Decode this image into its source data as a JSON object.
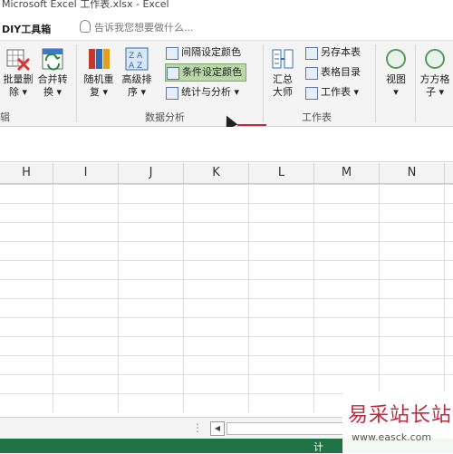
{
  "window": {
    "title": "Microsoft Excel 工作表.xlsx - Excel"
  },
  "tabs": {
    "diy": "DIY工具箱",
    "tell_me": "告诉我您想要做什么..."
  },
  "ribbon": {
    "buttons": {
      "batch_delete": [
        "批量删",
        "除 ▾"
      ],
      "merge_convert": [
        "合并转",
        "换 ▾"
      ],
      "random_repeat": [
        "随机重",
        "复 ▾"
      ],
      "advanced_sort": [
        "高级排",
        "序 ▾"
      ],
      "summary": [
        "汇总",
        "大师"
      ],
      "view": [
        "视图",
        "▾"
      ],
      "grid_sub": [
        "方方格",
        "子 ▾"
      ]
    },
    "small": {
      "interval_color": "间隔设定颜色",
      "conditional_color": "条件设定颜色",
      "stats_analysis": "统计与分析 ▾",
      "save_copy": "另存本表",
      "table_index": "表格目录",
      "worksheet": "工作表 ▾"
    },
    "groups": {
      "left_partial": "辑",
      "data_analysis": "数据分析",
      "worksheet": "工作表"
    }
  },
  "columns": [
    "H",
    "I",
    "J",
    "K",
    "L",
    "M",
    "N"
  ],
  "scrollbar": {
    "left_arrow": "◀",
    "dots": "⋮"
  },
  "statusbar": {
    "label": "计"
  },
  "watermark": {
    "title": "易采站长站",
    "url": "www.easck.com"
  }
}
